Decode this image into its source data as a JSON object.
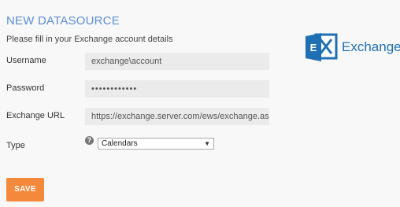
{
  "header": {
    "title": "NEW DATASOURCE",
    "subtitle": "Please fill in your Exchange account details"
  },
  "form": {
    "username": {
      "label": "Username",
      "value": "exchange\\account"
    },
    "password": {
      "label": "Password",
      "value": "••••••••••••"
    },
    "url": {
      "label": "Exchange URL",
      "value": "https://exchange.server.com/ews/exchange.as"
    },
    "type": {
      "label": "Type",
      "selected": "Calendars",
      "help_icon": "question-circle-icon"
    }
  },
  "actions": {
    "save_label": "SAVE"
  },
  "brand": {
    "name": "Exchange",
    "logo_icon": "exchange-logo-icon"
  },
  "colors": {
    "title": "#5b8fd6",
    "save_button": "#f5893b",
    "brand": "#1f6fb5",
    "field_background": "#ebebeb"
  }
}
